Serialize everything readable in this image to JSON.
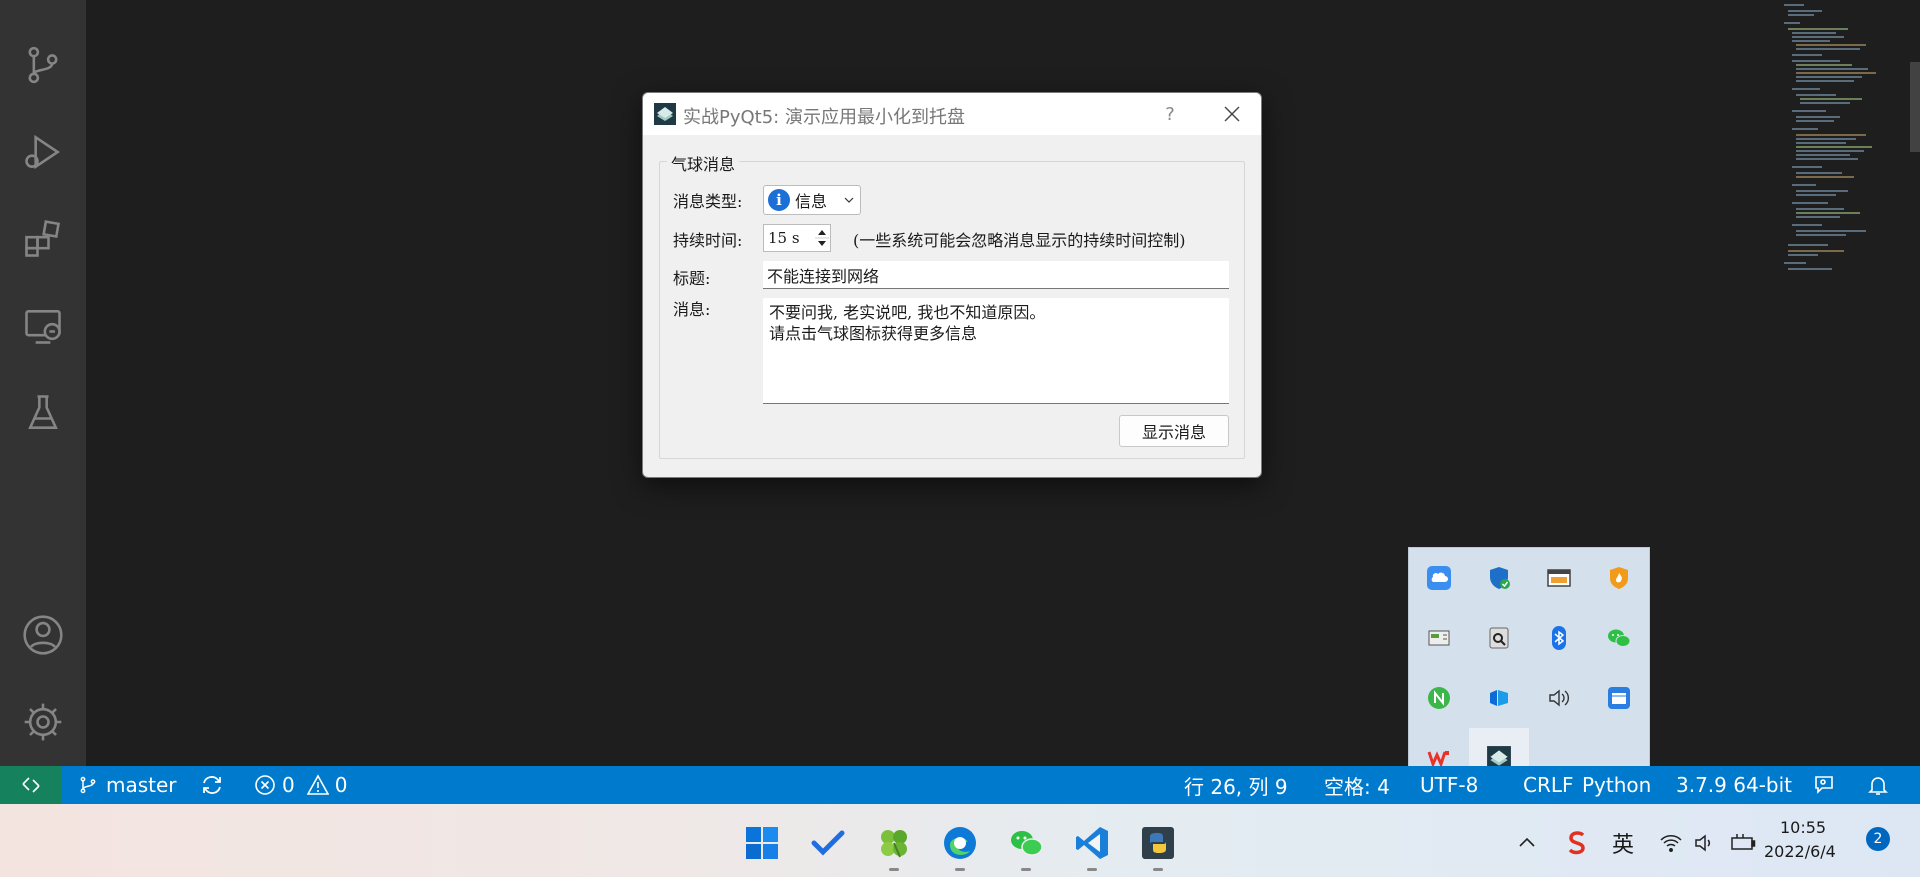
{
  "dialog": {
    "title": "实战PyQt5: 演示应用最小化到托盘",
    "help": "?",
    "group_title": "气球消息",
    "type_label": "消息类型:",
    "type_value": "信息",
    "duration_label": "持续时间:",
    "duration_value": "15 s",
    "duration_note": "(一些系统可能会忽略消息显示的持续时间控制)",
    "title_label": "标题:",
    "title_value": "不能连接到网络",
    "message_label": "消息:",
    "message_line1": "不要问我, 老实说吧, 我也不知道原因。",
    "message_line2": "请点击气球图标获得更多信息",
    "show_button": "显示消息"
  },
  "statusbar": {
    "branch": "master",
    "errors": "0",
    "warnings": "0",
    "position": "行 26, 列 9",
    "spaces": "空格: 4",
    "encoding": "UTF-8",
    "eol": "CRLF",
    "language": "Python",
    "interpreter": "3.7.9 64-bit"
  },
  "taskbar": {
    "ime": "英",
    "time": "10:55",
    "date": "2022/6/4",
    "notifications": "2"
  },
  "colors": {
    "statusbar": "#007acc",
    "remote": "#16825d",
    "activity_bar": "#333333",
    "editor": "#1e1e1e"
  }
}
